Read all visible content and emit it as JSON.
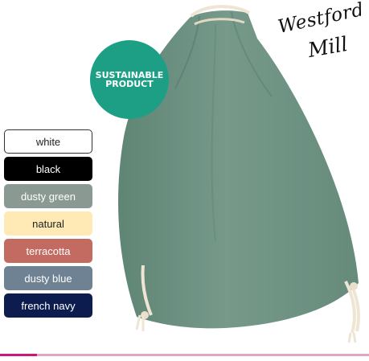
{
  "brand": {
    "line1": "Westford",
    "line2": "Mill"
  },
  "badge": {
    "line1": "SUSTAINABLE",
    "line2": "PRODUCT",
    "color": "#1d9f86"
  },
  "product": {
    "color": "#6e9484",
    "cord_color": "#f0e7d8"
  },
  "swatches": [
    {
      "label": "white",
      "bg": "#ffffff",
      "fg": "#222222",
      "border": "#333333"
    },
    {
      "label": "black",
      "bg": "#000000",
      "fg": "#ffffff",
      "border": "#000000"
    },
    {
      "label": "dusty green",
      "bg": "#8a9a93",
      "fg": "#ffffff",
      "border": "#8a9a93"
    },
    {
      "label": "natural",
      "bg": "#ffe9b4",
      "fg": "#222222",
      "border": "#ffe9b4"
    },
    {
      "label": "terracotta",
      "bg": "#c36a61",
      "fg": "#ffffff",
      "border": "#c36a61"
    },
    {
      "label": "dusty blue",
      "bg": "#6f8293",
      "fg": "#ffffff",
      "border": "#6f8293"
    },
    {
      "label": "french navy",
      "bg": "#0d1c4f",
      "fg": "#ffffff",
      "border": "#0d1c4f"
    }
  ],
  "accent": {
    "primary": "#d0157a",
    "secondary": "#e3a3c4"
  }
}
